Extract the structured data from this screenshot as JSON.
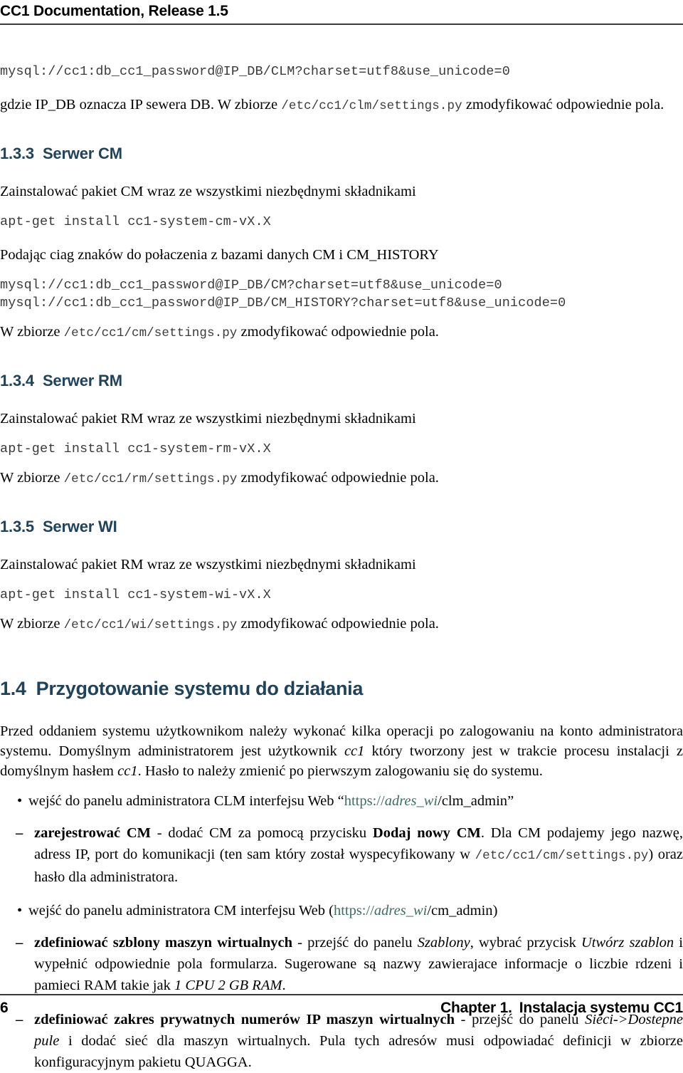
{
  "header": {
    "title": "CC1 Documentation, Release 1.5"
  },
  "footer": {
    "page_number": "6",
    "chapter_label": "Chapter 1.",
    "chapter_title": "Instalacja systemu CC1"
  },
  "content": {
    "clm_connstring": "mysql://cc1:db_cc1_password@IP_DB/CLM?charset=utf8&use_unicode=0",
    "clm_note_prefix": "gdzie IP_DB oznacza IP sewera DB. W zbiorze ",
    "clm_note_code": "/etc/cc1/clm/settings.py",
    "clm_note_suffix": " zmodyfikować odpowiednie pola.",
    "sec_133_num": "1.3.3",
    "sec_133_title": "Serwer CM",
    "cm_install_text": "Zainstalować pakiet CM wraz ze wszystkimi niezbędnymi składnikami",
    "cm_install_cmd": "apt-get install cc1-system-cm-vX.X",
    "cm_conn_intro": "Podając ciag znaków do połaczenia z bazami danych CM i CM_HISTORY",
    "cm_connstring_1": "mysql://cc1:db_cc1_password@IP_DB/CM?charset=utf8&use_unicode=0",
    "cm_connstring_2": "mysql://cc1:db_cc1_password@IP_DB/CM_HISTORY?charset=utf8&use_unicode=0",
    "cm_note_prefix": "W zbiorze ",
    "cm_note_code": "/etc/cc1/cm/settings.py",
    "cm_note_suffix": " zmodyfikować odpowiednie pola.",
    "sec_134_num": "1.3.4",
    "sec_134_title": "Serwer RM",
    "rm_install_text": "Zainstalować pakiet RM wraz ze wszystkimi niezbędnymi składnikami",
    "rm_install_cmd": "apt-get install cc1-system-rm-vX.X",
    "rm_note_prefix": "W zbiorze ",
    "rm_note_code": "/etc/cc1/rm/settings.py",
    "rm_note_suffix": " zmodyfikować odpowiednie pola.",
    "sec_135_num": "1.3.5",
    "sec_135_title": "Serwer WI",
    "wi_install_text": "Zainstalować pakiet RM wraz ze wszystkimi niezbędnymi składnikami",
    "wi_install_cmd": "apt-get install cc1-system-wi-vX.X",
    "wi_note_prefix": "W zbiorze ",
    "wi_note_code": "/etc/cc1/wi/settings.py",
    "wi_note_suffix": " zmodyfikować odpowiednie pola.",
    "sec_14_num": "1.4",
    "sec_14_title": "Przygotowanie systemu do działania",
    "intro_p1": "Przed oddaniem systemu użytkownikom należy wykonać kilka operacji po zalogowaniu na konto administratora systemu. Domyślnym administratorem jest użytkownik ",
    "intro_user": "cc1",
    "intro_p2": " który tworzony jest w trakcie procesu instalacji z domyślnym hasłem ",
    "intro_pass": "cc1",
    "intro_p3": ". Hasło to należy zmienić po pierwszym zalogowaniu się do systemu.",
    "bullet1_pre": "wejść do panelu administratora CLM interfejsu Web “",
    "bullet1_link_scheme": "https://",
    "bullet1_link_host": "adres_wi",
    "bullet1_link_path": "/clm_admin",
    "bullet1_post": "”",
    "sub1_bold": "zarejestrować CM",
    "sub1_t1": " - dodać CM za pomocą przycisku ",
    "sub1_bold2": "Dodaj nowy CM",
    "sub1_t2": ". Dla CM podajemy jego nazwę, adress IP, port do komunikacji (ten sam który został wyspecyfikowany w ",
    "sub1_code": "/etc/cc1/cm/settings.py",
    "sub1_t3": ") oraz hasło dla administratora.",
    "bullet2_pre": "wejść do panelu administratora CM interfejsu Web (",
    "bullet2_link_scheme": "https://",
    "bullet2_link_host": "adres_wi",
    "bullet2_link_path": "/cm_admin",
    "bullet2_post": ")",
    "sub2_bold": "zdefiniować szblony maszyn wirtualnych",
    "sub2_t1": " - przejść do panelu ",
    "sub2_i1": "Szablony",
    "sub2_t2": ", wybrać przycisk ",
    "sub2_i2": "Utwórz szablon",
    "sub2_t3": " i wypełnić odpowiednie pola formularza. Sugerowane są nazwy zawierajace informacje o liczbie rdzeni i pamieci RAM takie jak ",
    "sub2_i3": "1 CPU 2 GB RAM",
    "sub2_t4": ".",
    "sub3_bold": "zdefiniować zakres prywatnych numerów IP maszyn wirtualnych",
    "sub3_t1": " - przejść do panelu ",
    "sub3_i1": "Sieci->Dostepne pule",
    "sub3_t2": " i dodać sieć dla maszyn wirtualnych. Pula tych adresów musi odpowiadać definicji w zbiorze konfiguracyjnym pakietu QUAGGA."
  },
  "colors": {
    "heading": "#20435c",
    "link": "#3c6e63",
    "code": "#3b3b3b",
    "rule": "#3a3a3a"
  }
}
